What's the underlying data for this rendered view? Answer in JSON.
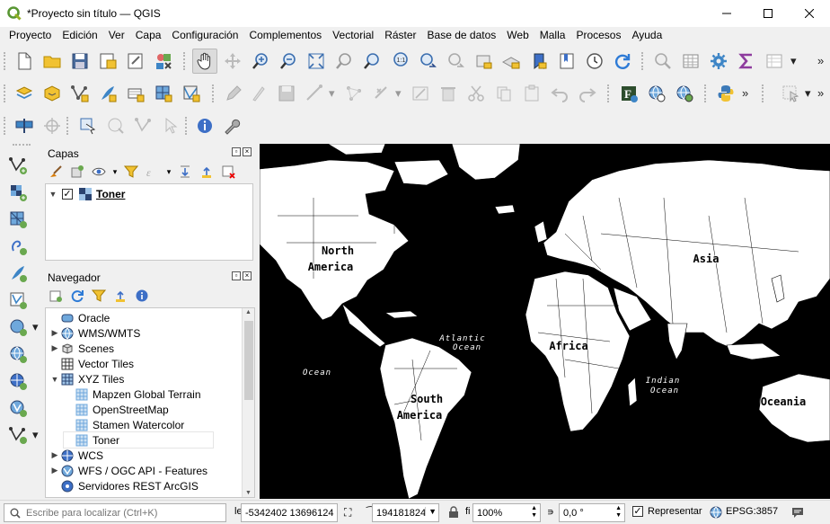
{
  "window": {
    "title": "*Proyecto sin título — QGIS"
  },
  "menu": [
    "Proyecto",
    "Edición",
    "Ver",
    "Capa",
    "Configuración",
    "Complementos",
    "Vectorial",
    "Ráster",
    "Base de datos",
    "Web",
    "Malla",
    "Procesos",
    "Ayuda"
  ],
  "layers_panel": {
    "title": "Capas",
    "layers": [
      {
        "name": "Toner",
        "checked": true
      }
    ]
  },
  "browser_panel": {
    "title": "Navegador",
    "items": [
      {
        "label": "Oracle",
        "level": 0,
        "expand": "",
        "icon": "oracle-icon"
      },
      {
        "label": "WMS/WMTS",
        "level": 0,
        "expand": "collapsed",
        "icon": "wms-icon"
      },
      {
        "label": "Scenes",
        "level": 0,
        "expand": "collapsed",
        "icon": "scenes-icon"
      },
      {
        "label": "Vector Tiles",
        "level": 0,
        "expand": "",
        "icon": "vector-tiles-icon"
      },
      {
        "label": "XYZ Tiles",
        "level": 0,
        "expand": "expanded",
        "icon": "xyz-tiles-icon"
      },
      {
        "label": "Mapzen Global Terrain",
        "level": 1,
        "expand": "",
        "icon": "xyz-layer-icon"
      },
      {
        "label": "OpenStreetMap",
        "level": 1,
        "expand": "",
        "icon": "xyz-layer-icon"
      },
      {
        "label": "Stamen Watercolor",
        "level": 1,
        "expand": "",
        "icon": "xyz-layer-icon"
      },
      {
        "label": "Toner",
        "level": 1,
        "expand": "",
        "icon": "xyz-layer-icon",
        "selected": true
      },
      {
        "label": "WCS",
        "level": 0,
        "expand": "collapsed",
        "icon": "wcs-icon"
      },
      {
        "label": "WFS / OGC API - Features",
        "level": 0,
        "expand": "collapsed",
        "icon": "wfs-icon"
      },
      {
        "label": "Servidores REST ArcGIS",
        "level": 0,
        "expand": "",
        "icon": "arcgis-icon"
      }
    ]
  },
  "map": {
    "labels": [
      {
        "text": "North",
        "kind": "continent"
      },
      {
        "text": "America",
        "kind": "continent"
      },
      {
        "text": "Asia",
        "kind": "continent"
      },
      {
        "text": "Africa",
        "kind": "continent"
      },
      {
        "text": "South",
        "kind": "continent"
      },
      {
        "text": "America",
        "kind": "continent"
      },
      {
        "text": "Oceania",
        "kind": "continent"
      },
      {
        "text": "Atlantic",
        "kind": "ocean"
      },
      {
        "text": "Ocean",
        "kind": "ocean"
      },
      {
        "text": "Ocean",
        "kind": "ocean"
      },
      {
        "text": "Indian",
        "kind": "ocean"
      },
      {
        "text": "Ocean",
        "kind": "ocean"
      }
    ]
  },
  "status": {
    "locator_placeholder": "Escribe para localizar (Ctrl+K)",
    "coord_prefix": "le",
    "coordinate": "-5342402  13696124",
    "scale_prefix": "⁀",
    "scale": "194181824",
    "magnifier_prefix": "fi",
    "magnifier": "100%",
    "rotation_prefix": "∍",
    "rotation": "0,0 °",
    "render_label": "Representar",
    "render_checked": true,
    "crs": "EPSG:3857"
  }
}
